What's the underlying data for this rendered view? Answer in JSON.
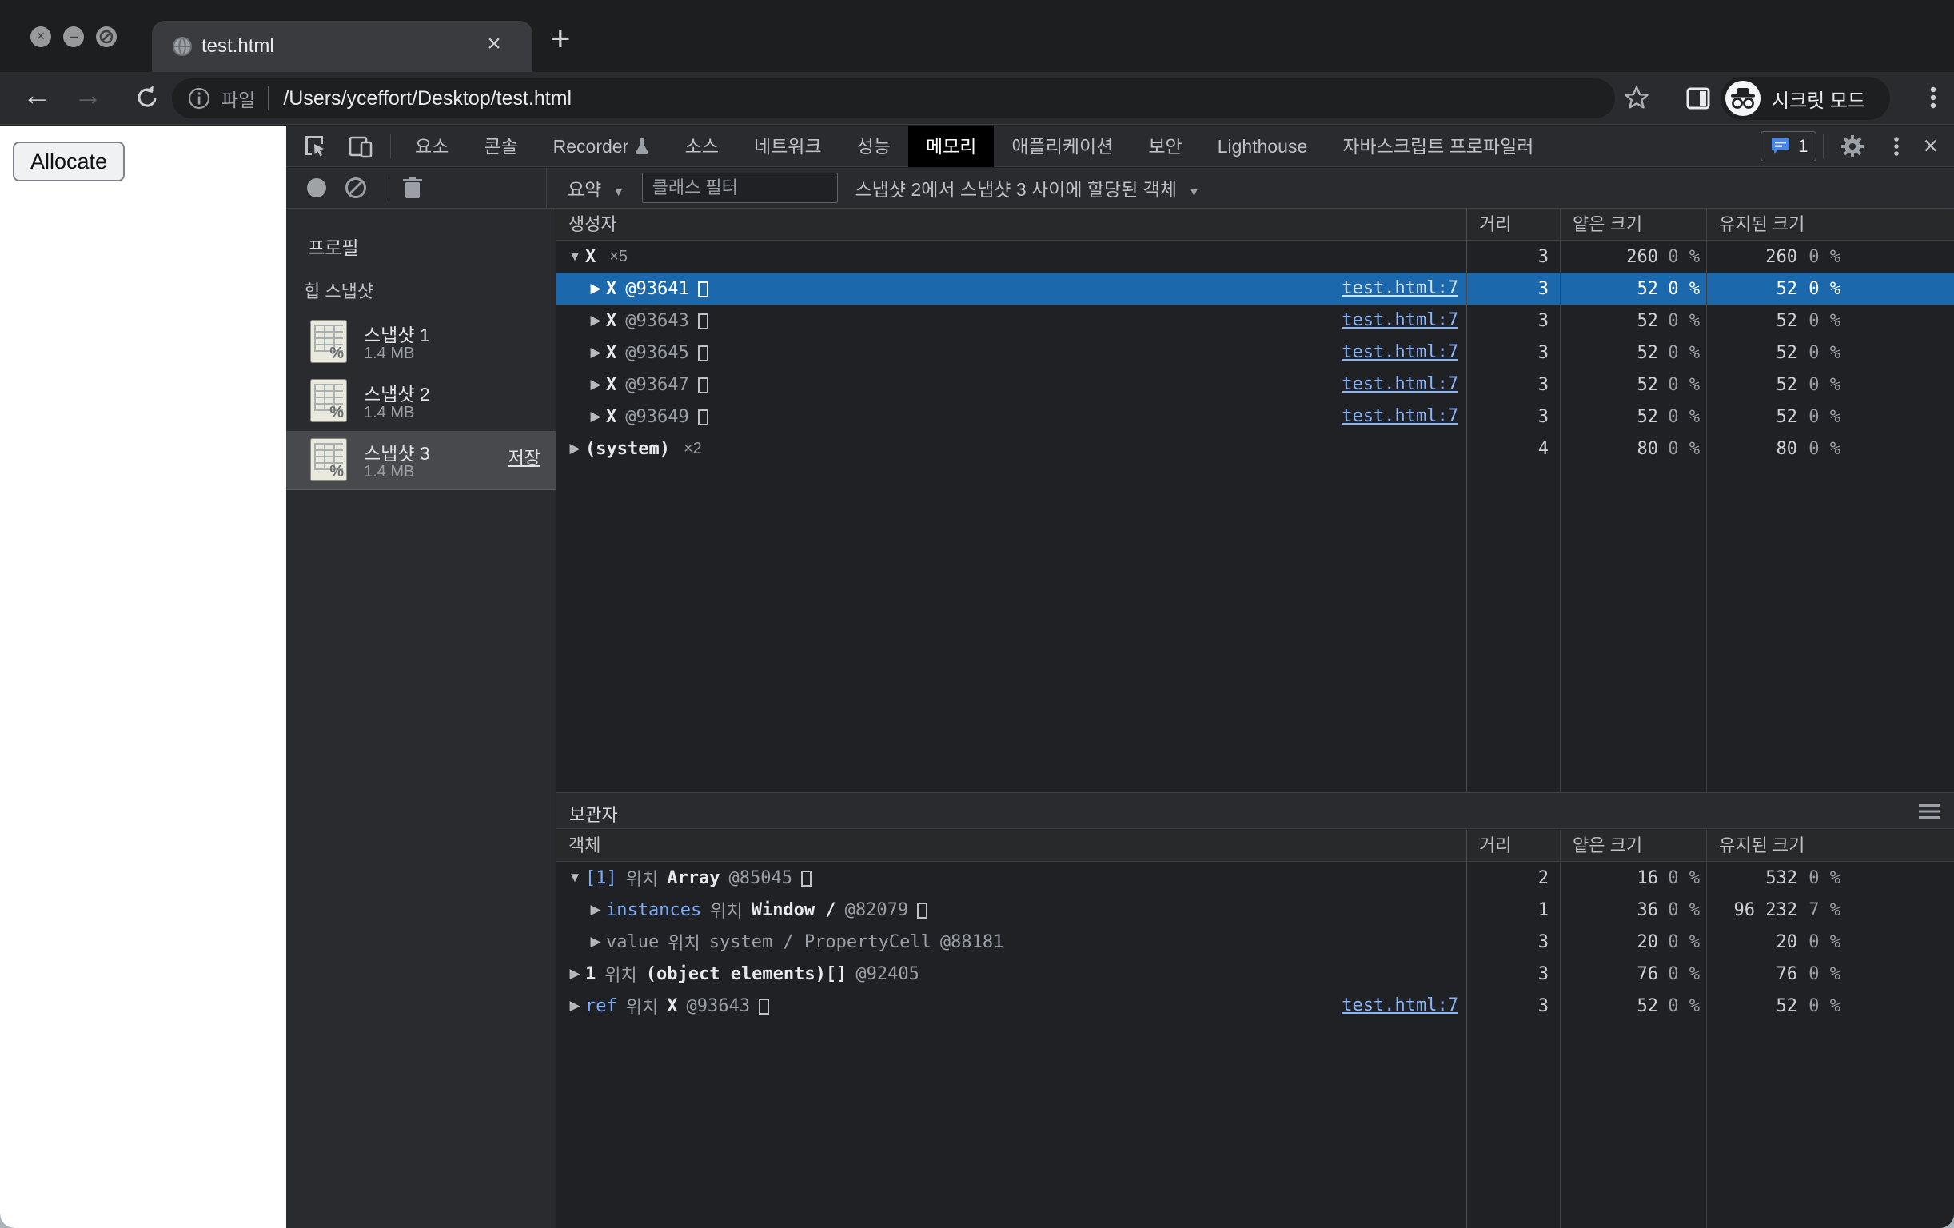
{
  "browser": {
    "tab_title": "test.html",
    "url_scheme_label": "파일",
    "url": "/Users/yceffort/Desktop/test.html",
    "incognito_label": "시크릿 모드"
  },
  "page": {
    "allocate_button": "Allocate"
  },
  "devtools": {
    "tabs": [
      {
        "label": "요소",
        "selected": false
      },
      {
        "label": "콘솔",
        "selected": false
      },
      {
        "label": "Recorder",
        "selected": false,
        "flask_icon": true
      },
      {
        "label": "소스",
        "selected": false
      },
      {
        "label": "네트워크",
        "selected": false
      },
      {
        "label": "성능",
        "selected": false
      },
      {
        "label": "메모리",
        "selected": true
      },
      {
        "label": "애플리케이션",
        "selected": false
      },
      {
        "label": "보안",
        "selected": false
      },
      {
        "label": "Lighthouse",
        "selected": false
      },
      {
        "label": "자바스크립트 프로파일러",
        "selected": false
      }
    ],
    "issues_count": "1",
    "toolbar": {
      "summary_label": "요약",
      "class_filter_placeholder": "클래스 필터",
      "allocation_label": "스냅샷 2에서 스냅샷 3 사이에 할당된 객체"
    },
    "sidebar": {
      "profiles_label": "프로필",
      "heap_label": "힙 스냅샷",
      "save_label": "저장",
      "snapshots": [
        {
          "name": "스냅샷 1",
          "size": "1.4 MB",
          "selected": false
        },
        {
          "name": "스냅샷 2",
          "size": "1.4 MB",
          "selected": false
        },
        {
          "name": "스냅샷 3",
          "size": "1.4 MB",
          "selected": true
        }
      ]
    },
    "constructor_grid": {
      "columns": [
        "생성자",
        "거리",
        "얕은 크기",
        "유지된 크기"
      ],
      "rows": [
        {
          "level": 0,
          "exp": "▼",
          "segs": [
            {
              "t": "X",
              "s": "name"
            },
            {
              "t": "×5",
              "s": "count"
            }
          ],
          "distance": "3",
          "shallow": "260",
          "shallow_pct": "0 %",
          "retained": "260",
          "retained_pct": "0 %",
          "selected": false,
          "link": ""
        },
        {
          "level": 1,
          "exp": "▶",
          "segs": [
            {
              "t": "X",
              "s": "name"
            },
            {
              "t": "@93641",
              "s": "dim"
            },
            {
              "t": "",
              "s": "box"
            }
          ],
          "distance": "3",
          "shallow": "52",
          "shallow_pct": "0 %",
          "retained": "52",
          "retained_pct": "0 %",
          "selected": true,
          "link": "test.html:7"
        },
        {
          "level": 1,
          "exp": "▶",
          "segs": [
            {
              "t": "X",
              "s": "name"
            },
            {
              "t": "@93643",
              "s": "dim"
            },
            {
              "t": "",
              "s": "box"
            }
          ],
          "distance": "3",
          "shallow": "52",
          "shallow_pct": "0 %",
          "retained": "52",
          "retained_pct": "0 %",
          "selected": false,
          "link": "test.html:7"
        },
        {
          "level": 1,
          "exp": "▶",
          "segs": [
            {
              "t": "X",
              "s": "name"
            },
            {
              "t": "@93645",
              "s": "dim"
            },
            {
              "t": "",
              "s": "box"
            }
          ],
          "distance": "3",
          "shallow": "52",
          "shallow_pct": "0 %",
          "retained": "52",
          "retained_pct": "0 %",
          "selected": false,
          "link": "test.html:7"
        },
        {
          "level": 1,
          "exp": "▶",
          "segs": [
            {
              "t": "X",
              "s": "name"
            },
            {
              "t": "@93647",
              "s": "dim"
            },
            {
              "t": "",
              "s": "box"
            }
          ],
          "distance": "3",
          "shallow": "52",
          "shallow_pct": "0 %",
          "retained": "52",
          "retained_pct": "0 %",
          "selected": false,
          "link": "test.html:7"
        },
        {
          "level": 1,
          "exp": "▶",
          "segs": [
            {
              "t": "X",
              "s": "name"
            },
            {
              "t": "@93649",
              "s": "dim"
            },
            {
              "t": "",
              "s": "box"
            }
          ],
          "distance": "3",
          "shallow": "52",
          "shallow_pct": "0 %",
          "retained": "52",
          "retained_pct": "0 %",
          "selected": false,
          "link": "test.html:7"
        },
        {
          "level": 0,
          "exp": "▶",
          "segs": [
            {
              "t": "(system)",
              "s": "name"
            },
            {
              "t": "×2",
              "s": "count"
            }
          ],
          "distance": "4",
          "shallow": "80",
          "shallow_pct": "0 %",
          "retained": "80",
          "retained_pct": "0 %",
          "selected": false,
          "link": ""
        }
      ]
    },
    "retainers_grid": {
      "title": "보관자",
      "columns": [
        "객체",
        "거리",
        "얕은 크기",
        "유지된 크기"
      ],
      "rows": [
        {
          "level": 0,
          "exp": "▼",
          "segs": [
            {
              "t": "[1]",
              "s": "prop"
            },
            {
              "t": "위치",
              "s": "dim"
            },
            {
              "t": "Array",
              "s": "name"
            },
            {
              "t": "@85045",
              "s": "dim"
            },
            {
              "t": "",
              "s": "box"
            }
          ],
          "distance": "2",
          "shallow": "16",
          "shallow_pct": "0 %",
          "retained": "532",
          "retained_pct": "0 %",
          "selected": false,
          "link": ""
        },
        {
          "level": 1,
          "exp": "▶",
          "segs": [
            {
              "t": "instances",
              "s": "prop"
            },
            {
              "t": "위치",
              "s": "dim"
            },
            {
              "t": "Window /",
              "s": "name"
            },
            {
              "t": "@82079",
              "s": "dim"
            },
            {
              "t": "",
              "s": "box"
            }
          ],
          "distance": "1",
          "shallow": "36",
          "shallow_pct": "0 %",
          "retained": "96 232",
          "retained_pct": "7 %",
          "selected": false,
          "link": ""
        },
        {
          "level": 1,
          "exp": "▶",
          "segs": [
            {
              "t": "value",
              "s": "dim"
            },
            {
              "t": "위치",
              "s": "dim"
            },
            {
              "t": "system / PropertyCell",
              "s": "dim"
            },
            {
              "t": "@88181",
              "s": "dim"
            }
          ],
          "distance": "3",
          "shallow": "20",
          "shallow_pct": "0 %",
          "retained": "20",
          "retained_pct": "0 %",
          "selected": false,
          "link": ""
        },
        {
          "level": 0,
          "exp": "▶",
          "segs": [
            {
              "t": "1",
              "s": "name"
            },
            {
              "t": "위치",
              "s": "dim"
            },
            {
              "t": "(object elements)[]",
              "s": "bold"
            },
            {
              "t": "@92405",
              "s": "dim"
            }
          ],
          "distance": "3",
          "shallow": "76",
          "shallow_pct": "0 %",
          "retained": "76",
          "retained_pct": "0 %",
          "selected": false,
          "link": ""
        },
        {
          "level": 0,
          "exp": "▶",
          "segs": [
            {
              "t": "ref",
              "s": "prop"
            },
            {
              "t": "위치",
              "s": "dim"
            },
            {
              "t": "X",
              "s": "name"
            },
            {
              "t": "@93643",
              "s": "dim"
            },
            {
              "t": "",
              "s": "box"
            }
          ],
          "distance": "3",
          "shallow": "52",
          "shallow_pct": "0 %",
          "retained": "52",
          "retained_pct": "0 %",
          "selected": false,
          "link": "test.html:7"
        }
      ]
    }
  },
  "colors": {
    "selection_blue": "#1b69ac",
    "link_blue": "#8ab4f8",
    "property_blue": "#7cacf8",
    "issues_blue": "#4285f4",
    "devtools_bg": "#202124",
    "chrome_bg": "#2a2b2e"
  }
}
